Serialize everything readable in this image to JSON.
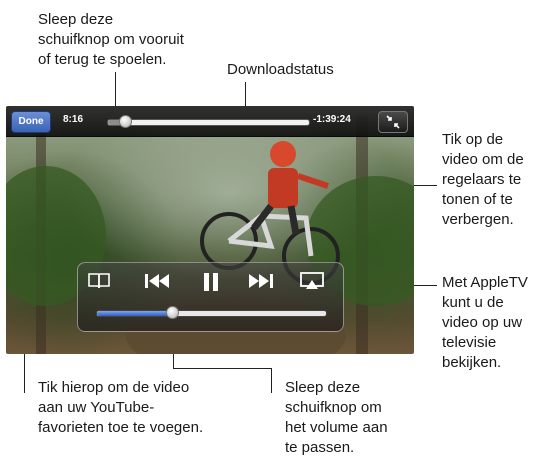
{
  "callouts": {
    "scrub": "Sleep deze\nschuifknop om vooruit\nof terug te spoelen.",
    "download": "Downloadstatus",
    "tap_video": "Tik op de\nvideo om de\nregelaars te\ntonen of te\nverbergen.",
    "appletv": "Met AppleTV\nkunt u de\nvideo op uw\ntelevisie\nbekijken.",
    "favorites": "Tik hierop om de video\naan uw YouTube-\nfavorieten toe te voegen.",
    "volume": "Sleep deze\nschuifknop om\nhet volume aan\nte passen."
  },
  "player": {
    "done_label": "Done",
    "elapsed": "8:16",
    "remaining": "-1:39:24",
    "progress": 0.09,
    "volume": 0.33,
    "icons": {
      "bookmark": "book-icon",
      "previous": "previous-track-icon",
      "pause": "pause-icon",
      "next": "next-track-icon",
      "airplay": "airplay-icon",
      "shrink": "shrink-icon"
    }
  },
  "colors": {
    "done_button": "#3a63b6",
    "volume_fill": "#2f5fc0"
  }
}
